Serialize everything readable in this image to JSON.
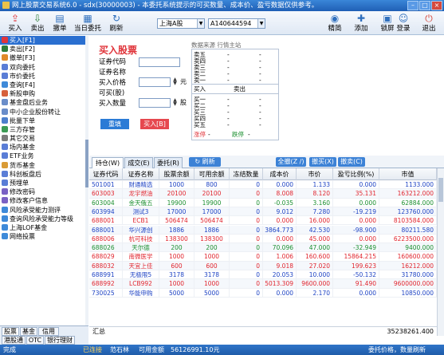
{
  "title": "网上股票交易系统6.0 - sdx(30000003) - 本委托系统提示的可买数量、成本价、盈亏数据仅供参考。",
  "toolbar": {
    "buy": "买入",
    "sell": "卖出",
    "cancel": "撤单",
    "query": "当日委托",
    "refresh": "刷新",
    "market": "上海A股",
    "account": "A140644594",
    "simple": "精简",
    "add": "添加",
    "lock": "锁屏",
    "login": "登录",
    "exit": "退出"
  },
  "sidebar": {
    "items": [
      {
        "label": "买入[F1]",
        "color": "#e0353b"
      },
      {
        "label": "卖出[F2]",
        "color": "#2d7d39"
      },
      {
        "label": "撤单[F3]",
        "color": "#e08a2a"
      },
      {
        "label": "双向委托",
        "color": "#5a7dd6"
      },
      {
        "label": "市价委托",
        "color": "#5a7dd6"
      },
      {
        "label": "查询[F4]",
        "color": "#3e8ad9"
      },
      {
        "label": "新股申购",
        "color": "#d6603c"
      },
      {
        "label": "基金盘后业务",
        "color": "#6a8dc9"
      },
      {
        "label": "中小企业股份转让",
        "color": "#6a8dc9"
      },
      {
        "label": "批量下单",
        "color": "#4d7fcc"
      },
      {
        "label": "三方存管",
        "color": "#3c9b55"
      },
      {
        "label": "其它交易",
        "color": "#7c7c7c"
      },
      {
        "label": "场内基金",
        "color": "#5a7dd6"
      },
      {
        "label": "ETF业务",
        "color": "#5a7dd6"
      },
      {
        "label": "货币基金",
        "color": "#d99b36"
      },
      {
        "label": "科创板盘后",
        "color": "#5a7dd6"
      },
      {
        "label": "预埋单",
        "color": "#5a7dd6"
      },
      {
        "label": "修改密码",
        "color": "#7a62c4"
      },
      {
        "label": "修改客户信息",
        "color": "#7a62c4"
      },
      {
        "label": "风险承受能力测评",
        "color": "#3e8ad9"
      },
      {
        "label": "查询风险承受能力等级",
        "color": "#3e8ad9"
      },
      {
        "label": "上海LOF基金",
        "color": "#3e8ad9"
      },
      {
        "label": "网络投票",
        "color": "#3e8ad9"
      }
    ],
    "tabs_top": [
      "股票",
      "基金",
      "信用"
    ],
    "tabs_bottom": [
      "港股通",
      "OTC",
      "银行理财"
    ]
  },
  "form": {
    "title": "买入股票",
    "code_label": "证券代码",
    "name_label": "证券名称",
    "price_label": "买入价格",
    "avail_label": "可买(股)",
    "qty_label": "买入数量",
    "price_unit": "元",
    "qty_unit": "股",
    "reset": "重填",
    "submit": "买入[B]"
  },
  "quote": {
    "header": "数据来源  行情主站",
    "sell_rows": [
      {
        "label": "卖五",
        "v1": "-",
        "v2": "-"
      },
      {
        "label": "卖四",
        "v1": "-",
        "v2": "-"
      },
      {
        "label": "卖三",
        "v1": "-",
        "v2": "-"
      },
      {
        "label": "卖二",
        "v1": "-",
        "v2": "-"
      },
      {
        "label": "卖一",
        "v1": "-",
        "v2": "-"
      }
    ],
    "col_buy": "买入",
    "col_sell": "卖出",
    "buy_rows": [
      {
        "label": "买一",
        "v1": "-",
        "v2": "-"
      },
      {
        "label": "买二",
        "v1": "-",
        "v2": "-"
      },
      {
        "label": "买三",
        "v1": "-",
        "v2": "-"
      },
      {
        "label": "买四",
        "v1": "-",
        "v2": "-"
      },
      {
        "label": "买五",
        "v1": "-",
        "v2": "-"
      }
    ],
    "limit_up": "涨停",
    "limit_down": "跌停",
    "limit_up_val": "-",
    "limit_down_val": "-"
  },
  "tabs": {
    "position": "持仓(W)",
    "deals": "成交(E)",
    "orders": "委托(R)",
    "refresh": "刷新",
    "all": "全撤(Z /)",
    "cancel_buy": "撤买(X)",
    "cancel_sell": "撤卖(C)"
  },
  "grid": {
    "headers": [
      "证券代码",
      "证券名称",
      "股票余额",
      "可用余额",
      "冻结数量",
      "成本价",
      "市价",
      "盈亏比例(%)",
      "市值"
    ],
    "rows": [
      [
        "501001",
        "财通精选",
        "1000",
        "800",
        "0",
        "0.000",
        "1.133",
        "0.000",
        "1133.000"
      ],
      [
        "603003",
        "龙宇燃油",
        "20100",
        "20100",
        "0",
        "8.008",
        "8.120",
        "35.131",
        "163212.000"
      ],
      [
        "603004",
        "金天俄五",
        "19900",
        "19900",
        "0",
        "-0.035",
        "3.160",
        "0.000",
        "62884.000"
      ],
      [
        "603994",
        "测试3",
        "17000",
        "17000",
        "0",
        "9.012",
        "7.280",
        "-19.219",
        "123760.000"
      ],
      [
        "688001",
        "ECB1",
        "506474",
        "506474",
        "0",
        "0.000",
        "16.000",
        "0.000",
        "8103584.000"
      ],
      [
        "688001",
        "华兴源创",
        "1886",
        "1886",
        "0",
        "3864.773",
        "42.530",
        "-98.900",
        "80211.580"
      ],
      [
        "688006",
        "杭可科技",
        "138300",
        "138300",
        "0",
        "0.000",
        "45.000",
        "0.000",
        "6223500.000"
      ],
      [
        "688026",
        "天尔德",
        "200",
        "200",
        "0",
        "70.096",
        "47.000",
        "-32.949",
        "9400.000"
      ],
      [
        "688029",
        "南微医学",
        "1000",
        "1000",
        "0",
        "1.006",
        "160.600",
        "15864.215",
        "160600.000"
      ],
      [
        "688032",
        "天宜上佳",
        "600",
        "600",
        "0",
        "9.018",
        "27.020",
        "199.623",
        "16212.000"
      ],
      [
        "688991",
        "无极限5",
        "3178",
        "3178",
        "0",
        "20.053",
        "10.000",
        "-50.132",
        "31780.000"
      ],
      [
        "688992",
        "LCB992",
        "1000",
        "1000",
        "0",
        "5013.309",
        "9600.000",
        "91.490",
        "9600000.000"
      ],
      [
        "730025",
        "华能申购",
        "5000",
        "5000",
        "0",
        "0.000",
        "2.170",
        "0.000",
        "10850.000"
      ]
    ],
    "row_colors": [
      "blue",
      "red",
      "green",
      "blue",
      "red",
      "blue",
      "red",
      "green",
      "red",
      "red",
      "blue",
      "red",
      "blue"
    ],
    "total_label": "汇总",
    "total_value": "35238261.400"
  },
  "status": {
    "ready": "完成",
    "connected": "已连接",
    "broker": "范石林",
    "balance_label": "可用金额",
    "balance": "56126991.10元",
    "right": "委托价格，数量刷新"
  }
}
